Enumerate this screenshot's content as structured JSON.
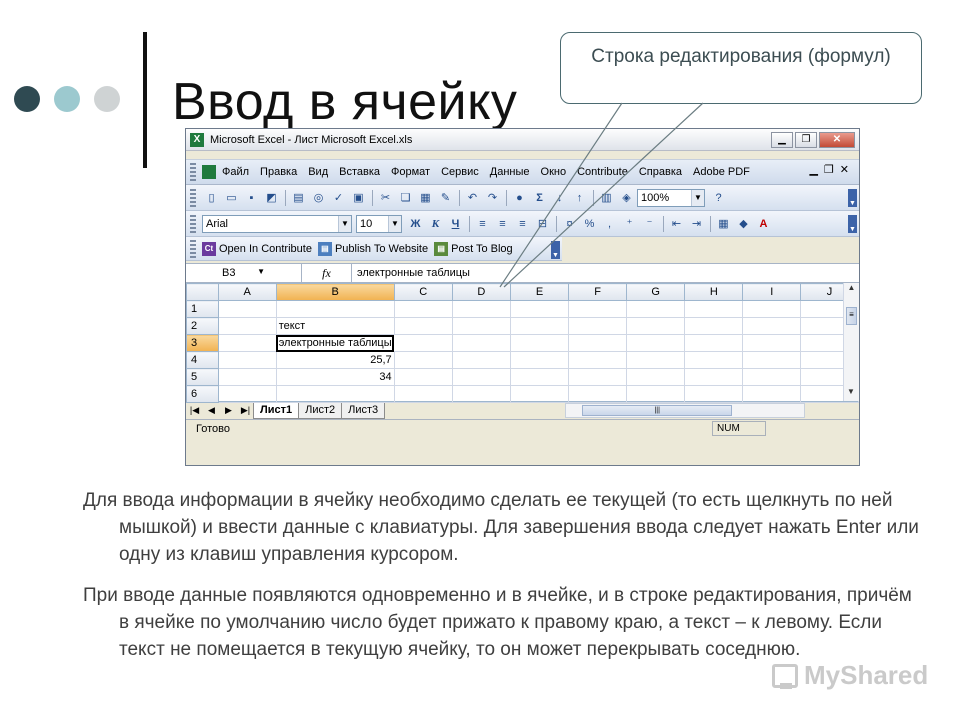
{
  "slide": {
    "title": "Ввод в ячейку",
    "callout": "Строка редактирования (формул)",
    "paragraph1": "Для ввода информации в ячейку необходимо сделать ее текущей (то есть щелкнуть по ней мышкой)  и ввести данные с клавиатуры. Для завершения ввода следует нажать Enter или одну из клавиш управления курсором.",
    "paragraph2": "При вводе данные появляются одновременно и в ячейке, и в строке редактирования, причём в ячейке по умолчанию число будет прижато к правому краю, а текст – к левому. Если текст не помещается в текущую ячейку, то он может перекрывать соседнюю.",
    "watermark": "MyShared"
  },
  "colors": {
    "dot1": "#2f4a52",
    "dot2": "#9cc9cf",
    "dot3": "#cfd3d4",
    "selected_header": "#f1b250",
    "titlebar_close": "#c24a35"
  },
  "excel": {
    "window_title": "Microsoft Excel - Лист Microsoft Excel.xls",
    "menu": [
      "Файл",
      "Правка",
      "Вид",
      "Вставка",
      "Формат",
      "Сервис",
      "Данные",
      "Окно",
      "Contribute",
      "Справка",
      "Adobe PDF"
    ],
    "zoom": "100%",
    "font_name": "Arial",
    "font_size": "10",
    "format_buttons": {
      "bold": "Ж",
      "italic": "К",
      "underline": "Ч"
    },
    "contribute": [
      "Open In Contribute",
      "Publish To Website",
      "Post To Blog"
    ],
    "name_box": "B3",
    "fx_label": "fx",
    "formula_value": "электронные таблицы",
    "columns": [
      "A",
      "B",
      "C",
      "D",
      "E",
      "F",
      "G",
      "H",
      "I",
      "J"
    ],
    "rows": [
      {
        "n": "1",
        "b": ""
      },
      {
        "n": "2",
        "b": "текст"
      },
      {
        "n": "3",
        "b": "электронные таблицы"
      },
      {
        "n": "4",
        "b": "25,7"
      },
      {
        "n": "5",
        "b": "34"
      },
      {
        "n": "6",
        "b": ""
      }
    ],
    "sheets": [
      "Лист1",
      "Лист2",
      "Лист3"
    ],
    "status": "Готово",
    "status_num": "NUM"
  }
}
